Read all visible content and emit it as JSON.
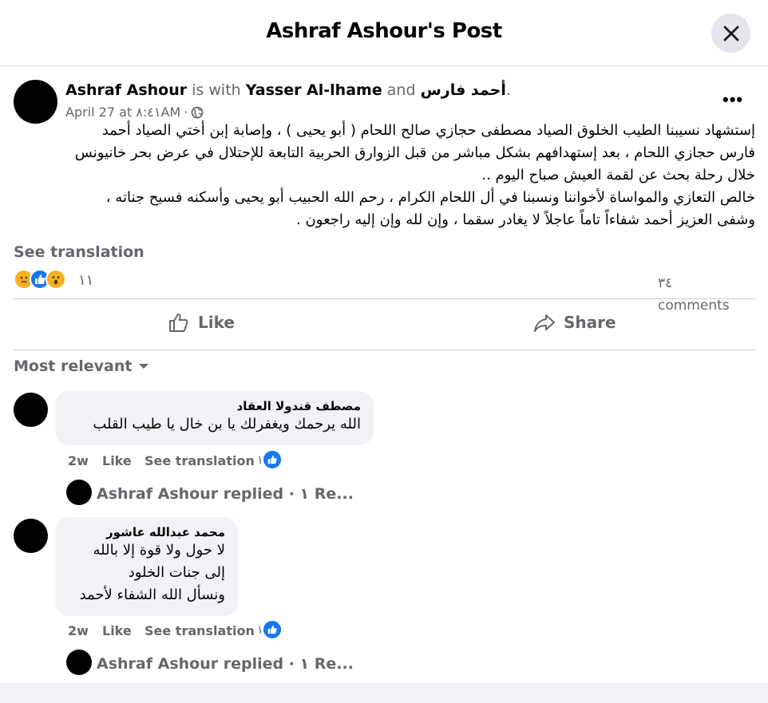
{
  "dialog": {
    "title": "Ashraf Ashour's Post"
  },
  "post": {
    "author": "Ashraf Ashour",
    "is_with": "is with",
    "with_user1": "Yasser Al-lhame",
    "and_text": "and",
    "with_user2": "أحمد فارس",
    "period": ".",
    "date": "April 27 at ٨:٤١AM",
    "dot": "·",
    "more_label": "•••",
    "body_lines": [
      "إستشهاد نسيبنا الطيب الخلوق الصياد مصطفى حجازي صالح اللحام ( أبو يحيى ) ، وإصابة إبن أختي الصياد أحمد",
      "فارس حجازي اللحام ، بعد إستهدافهم بشكل مباشر من قبل الزوارق الحربية التابعة للإحتلال في عرض بحر خانيونس",
      "خلال رحلة بحث عن لقمة العيش صباح اليوم ..",
      "خالص التعازي والمواساة لأخواننا ونسبنا في أل اللحام الكرام ، رحم الله الحبيب أبو يحيى وأسكنه فسيح جناته ،",
      "وشفى العزيز أحمد شفاءاً تاماً عاجلاً لا يغادر سقما ، وإن لله وإن إليه راجعون ."
    ],
    "see_translation": "See translation",
    "reaction_count": "١١",
    "comments_count": "٣٤ comments",
    "reaction_icons": [
      "sad-reaction-icon",
      "like-reaction-icon",
      "wow-reaction-icon"
    ]
  },
  "actions": {
    "like": "Like",
    "share": "Share"
  },
  "filter": {
    "label": "Most relevant"
  },
  "comments": [
    {
      "name": "مصطف قندولا العقاد",
      "lines": [
        "الله يرحمك ويغفرلك يا بن خال يا طيب القلب"
      ],
      "time": "2w",
      "like": "Like",
      "see_translation": "See translation",
      "like_count": "١",
      "reply_text": "Ashraf Ashour replied · ١ Re..."
    },
    {
      "name": "محمد عبدالله عاشور",
      "lines": [
        "لا حول ولا قوة إلا بالله",
        "إلى جنات الخلود",
        "ونسأل الله الشفاء لأحمد"
      ],
      "time": "2w",
      "like": "Like",
      "see_translation": "See translation",
      "like_count": "١",
      "reply_text": "Ashraf Ashour replied · ١ Re..."
    }
  ],
  "colors": {
    "accent": "#1877f2",
    "muted": "#65676b",
    "bubble": "#f0f2f5"
  }
}
